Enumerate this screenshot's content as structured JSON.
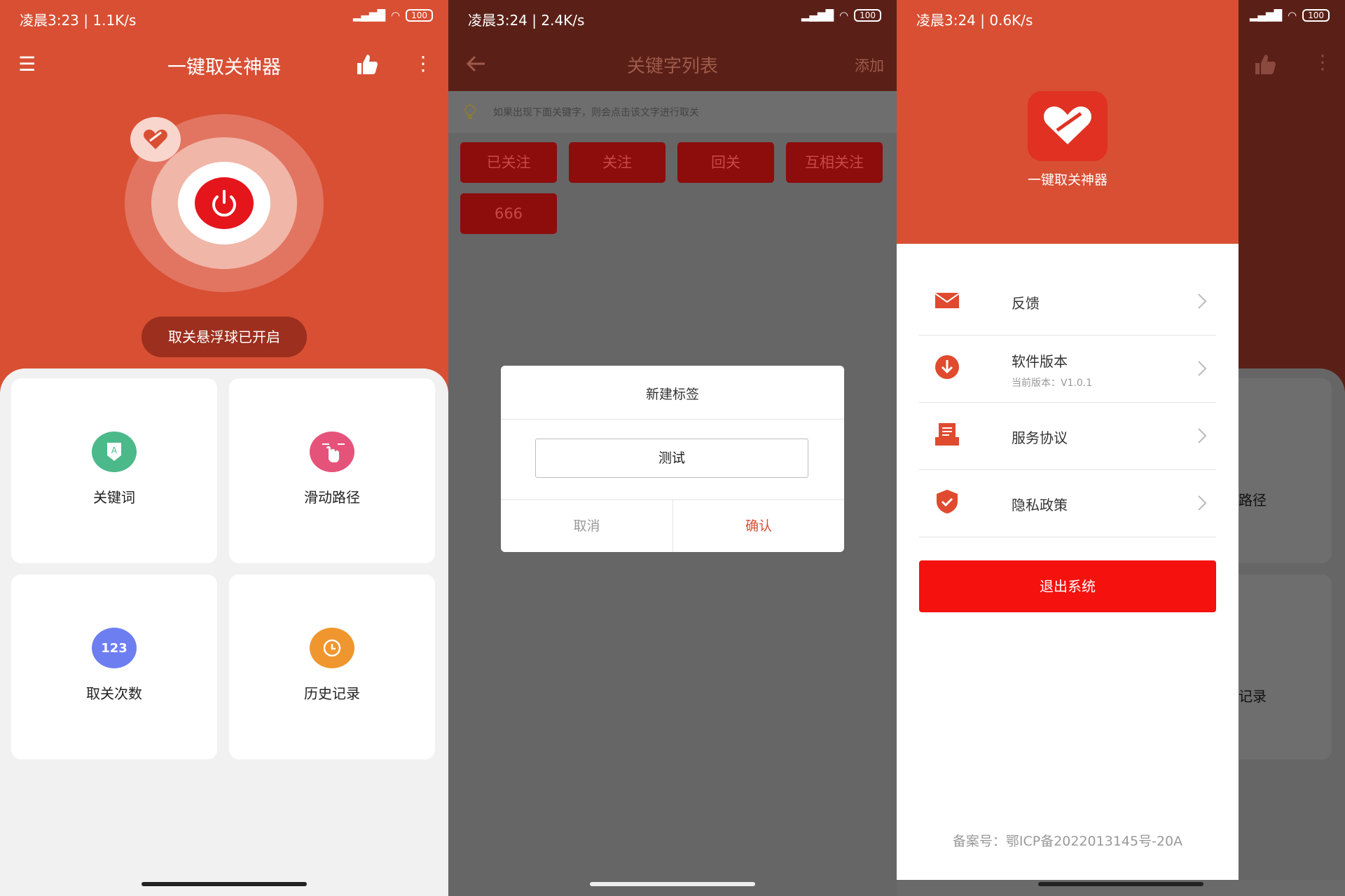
{
  "panel1": {
    "status": {
      "time": "凌晨3:23 | 1.1K/s",
      "battery": "100"
    },
    "title": "一键取关神器",
    "float_status": "取关悬浮球已开启",
    "cards": [
      {
        "label": "关键词",
        "icon": "keyword-icon",
        "color": "#4cb98a"
      },
      {
        "label": "滑动路径",
        "icon": "swipe-path-icon",
        "color": "#e6537a"
      },
      {
        "label": "取关次数",
        "icon": "count-icon",
        "color": "#6c7ef0"
      },
      {
        "label": "历史记录",
        "icon": "history-icon",
        "color": "#f0962e"
      }
    ],
    "count_glyph": "123"
  },
  "panel2": {
    "status": {
      "time": "凌晨3:24 | 2.4K/s",
      "battery": "100"
    },
    "title": "关键字列表",
    "add_label": "添加",
    "tip": "如果出现下面关键字，则会点击该文字进行取关",
    "tags": [
      "已关注",
      "关注",
      "回关",
      "互相关注",
      "666"
    ],
    "dialog": {
      "title": "新建标签",
      "input_value": "测试",
      "cancel": "取消",
      "confirm": "确认"
    }
  },
  "panel3": {
    "status": {
      "time": "凌晨3:24 | 0.6K/s",
      "battery": "100"
    },
    "app_name": "一键取关神器",
    "menu": [
      {
        "label": "反馈",
        "icon": "mail-icon"
      },
      {
        "label": "软件版本",
        "sub": "当前版本：V1.0.1",
        "icon": "download-icon"
      },
      {
        "label": "服务协议",
        "icon": "agreement-icon"
      },
      {
        "label": "隐私政策",
        "icon": "shield-icon"
      }
    ],
    "logout": "退出系统",
    "icp": "备案号：鄂ICP备2022013145号-20A",
    "bg_fragments": [
      "路径",
      "记录"
    ]
  },
  "colors": {
    "accent": "#d84f33",
    "power_red": "#e5151c",
    "logout_red": "#f5110e",
    "tag_red": "#8d0c0c"
  }
}
